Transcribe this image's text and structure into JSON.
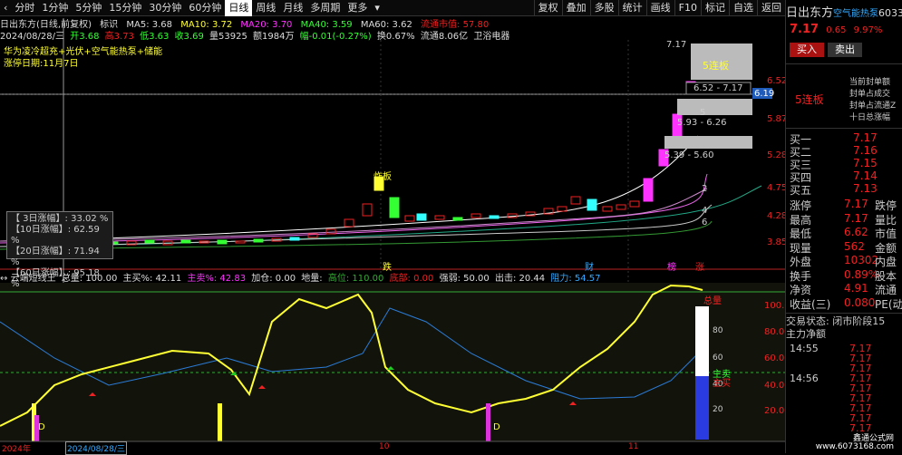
{
  "toolbar": {
    "periods": [
      "分时",
      "1分钟",
      "5分钟",
      "15分钟",
      "30分钟",
      "60分钟",
      "日线",
      "周线",
      "月线",
      "多周期",
      "更多"
    ],
    "selected": "日线",
    "right": [
      "复权",
      "叠加",
      "多股",
      "统计",
      "画线",
      "F10",
      "标记",
      "自选",
      "返回"
    ]
  },
  "header": {
    "title": "日出东方(日线,前复权)",
    "indicator": "标识",
    "ma5": "MA5: 3.68",
    "ma10": "MA10: 3.72",
    "ma20": "MA20: 3.70",
    "ma40": "MA40: 3.59",
    "ma60": "MA60: 3.62",
    "float_value": "流通市值: 57.80",
    "date": "2024/08/28/三",
    "open": "开3.68",
    "high": "高3.73",
    "low_label": "低3.63",
    "close": "收3.69",
    "vol": "量53925",
    "amount": "额1984万",
    "change": "幅-0.01(-0.27%)",
    "turnover": "换0.67%",
    "float_shares": "流通8.06亿",
    "industry": "卫浴电器"
  },
  "concepts": "华为凌冷超充+光伏+空气能热泵+储能",
  "limit_date": "涨停日期:11月7日",
  "annotations": {
    "note": "炸板",
    "boxes": [
      "5连板",
      "6.52 - 7.17",
      "5.93 - 6.26",
      "5.39 - 5.60"
    ],
    "box_top": "7.17",
    "ma_nums": [
      "2",
      "4",
      "6",
      "5"
    ],
    "events": [
      "跌",
      "财",
      "榜",
      "涨"
    ],
    "price_axis": [
      "6.52",
      "6.19",
      "5.87",
      "5.28",
      "4.75",
      "4.28",
      "3.85"
    ]
  },
  "popup": {
    "rows": [
      {
        "k": "【 3日涨幅】:",
        "v": "33.02 %"
      },
      {
        "k": "【10日涨幅】:",
        "v": "62.59 %"
      },
      {
        "k": "【20日涨幅】:",
        "v": "71.94 %"
      },
      {
        "k": "【60日涨幅】:",
        "v": "95.18 %"
      }
    ]
  },
  "indicator": {
    "name": "云端短线王",
    "total": "总量: 100.00",
    "main_buy": "主买%: 42.11",
    "main_sell": "主卖%: 42.83",
    "add": "加仓: 0.00",
    "ground": "地量:",
    "high_pos": "高位: 110.00",
    "bottom": "底部: 0.00",
    "strength": "强弱: 50.00",
    "exit": "出击: 20.44",
    "resist": "阻力: 54.57",
    "axis": [
      "100.0",
      "80.00",
      "60.00",
      "40.00",
      "20.00"
    ],
    "bar_axis": [
      "80",
      "60",
      "40",
      "20"
    ],
    "legend": [
      "总量",
      "主卖",
      "主买"
    ],
    "d_marks": [
      "D",
      "D"
    ]
  },
  "xaxis": [
    "2024年",
    "2024/08/28/三",
    "10",
    "11"
  ],
  "stock": {
    "name": "日出东方",
    "concept": "空气能热泵",
    "code": "6033",
    "price": "7.17",
    "chg": "0.65",
    "pct": "9.97%",
    "buy_btn": "买入",
    "sell_btn": "卖出",
    "five_lb": "5连板",
    "seal_info": [
      "当前封单额",
      "封单占成交",
      "封单占流通Z",
      "十日总涨幅"
    ],
    "sells": [],
    "buys": [
      {
        "k": "买一",
        "v": "7.17"
      },
      {
        "k": "买二",
        "v": "7.16"
      },
      {
        "k": "买三",
        "v": "7.15"
      },
      {
        "k": "买四",
        "v": "7.14"
      },
      {
        "k": "买五",
        "v": "7.13"
      }
    ],
    "stats": [
      {
        "k": "涨停",
        "v": "7.17",
        "k2": "跌停"
      },
      {
        "k": "最高",
        "v": "7.17",
        "k2": "量比"
      },
      {
        "k": "最低",
        "v": "6.62",
        "k2": "市值"
      },
      {
        "k": "现量",
        "v": "562",
        "k2": "金额"
      },
      {
        "k": "外盘",
        "v": "10302",
        "k2": "内盘"
      },
      {
        "k": "换手",
        "v": "0.89%",
        "k2": "股本"
      },
      {
        "k": "净资",
        "v": "4.91",
        "k2": "流通"
      },
      {
        "k": "收益(三)",
        "v": "0.080",
        "k2": "PE(动"
      }
    ],
    "trade_state": "交易状态: 闭市阶段",
    "trade_state_val": "15",
    "main_net": "主力净额",
    "ticks": [
      {
        "t": "14:55",
        "p": "7.17"
      },
      {
        "t": "",
        "p": "7.17"
      },
      {
        "t": "",
        "p": "7.17"
      },
      {
        "t": "14:56",
        "p": "7.17"
      },
      {
        "t": "",
        "p": "7.17"
      },
      {
        "t": "",
        "p": "7.17"
      },
      {
        "t": "",
        "p": "7.17"
      },
      {
        "t": "",
        "p": "7.17"
      },
      {
        "t": "",
        "p": "7.17"
      }
    ],
    "watermark": "鑫通公式网",
    "watermark_url": "www.6073168.com"
  }
}
